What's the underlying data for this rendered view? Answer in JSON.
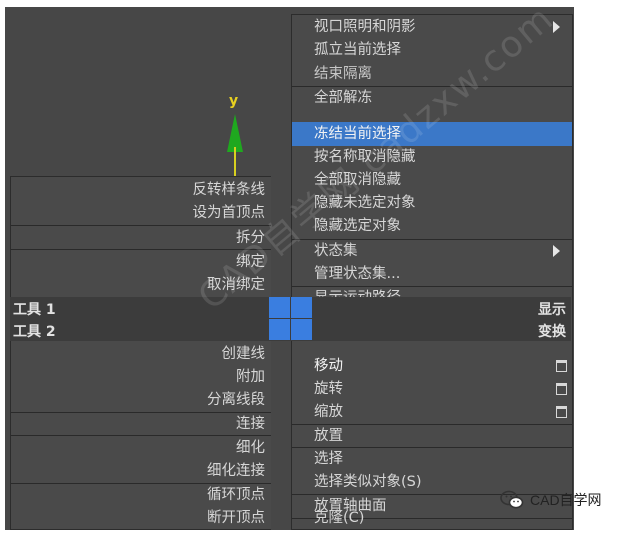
{
  "axis": {
    "label": "y"
  },
  "left_menu": {
    "groups": [
      [
        "反转样条线",
        "设为首顶点"
      ],
      [
        "拆分"
      ],
      [
        "绑定",
        "取消绑定"
      ],
      [
        "创建线",
        "附加",
        "分离线段"
      ],
      [
        "连接"
      ],
      [
        "细化",
        "细化连接"
      ],
      [
        "循环顶点",
        "断开顶点"
      ]
    ]
  },
  "right_menu": {
    "groups": [
      [
        "视口照明和阴影",
        "孤立当前选择",
        "结束隔离"
      ],
      [
        "全部解冻",
        "冻结当前选择",
        "按名称取消隐藏",
        "全部取消隐藏",
        "隐藏未选定对象",
        "隐藏选定对象"
      ],
      [
        "状态集",
        "管理状态集..."
      ],
      [
        "显示运动路径"
      ],
      [
        "移动",
        "旋转",
        "缩放"
      ],
      [
        "放置"
      ],
      [
        "选择",
        "选择类似对象(S)"
      ],
      [
        "放置轴曲面"
      ],
      [
        "克隆(C)"
      ]
    ],
    "selected": "冻结当前选择"
  },
  "quad_bars": {
    "tools1": "工具 1",
    "tools2": "工具 2",
    "display": "显示",
    "transform": "变换"
  },
  "watermark": "CAD自学网 cadzxw.com",
  "branding": {
    "wechat_label": "CAD自学网"
  },
  "colors": {
    "viewport": "#474747",
    "menu": "#4a4a4a",
    "highlight": "#3b78c8",
    "quad": "#3a7ee0"
  }
}
